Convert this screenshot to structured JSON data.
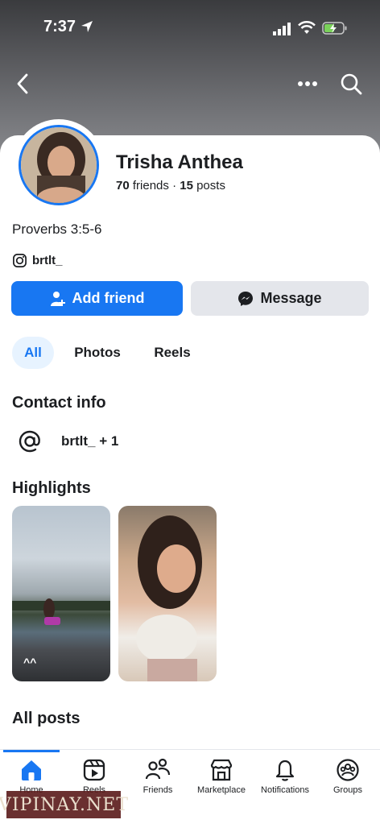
{
  "status_bar": {
    "time": "7:37"
  },
  "profile": {
    "name": "Trisha Anthea",
    "friends_count": "70",
    "friends_label": "friends",
    "separator": "·",
    "posts_count": "15",
    "posts_label": "posts",
    "bio": "Proverbs 3:5-6",
    "instagram": "brtlt_"
  },
  "actions": {
    "add_friend": "Add friend",
    "message": "Message"
  },
  "tabs": [
    {
      "label": "All",
      "active": true
    },
    {
      "label": "Photos"
    },
    {
      "label": "Reels"
    }
  ],
  "contact": {
    "heading": "Contact info",
    "value": "brtlt_ + 1"
  },
  "highlights": {
    "heading": "Highlights",
    "items": [
      {
        "caption": "^^"
      },
      {
        "caption": ""
      }
    ]
  },
  "posts": {
    "heading": "All posts"
  },
  "bottom_nav": [
    {
      "label": "Home",
      "icon": "home-icon"
    },
    {
      "label": "Reels",
      "icon": "reels-icon"
    },
    {
      "label": "Friends",
      "icon": "friends-icon"
    },
    {
      "label": "Marketplace",
      "icon": "marketplace-icon"
    },
    {
      "label": "Notifications",
      "icon": "bell-icon"
    },
    {
      "label": "Groups",
      "icon": "groups-icon"
    }
  ],
  "watermark": "VIPINAY.NET",
  "colors": {
    "accent": "#1877f2",
    "button_gray": "#e4e6eb",
    "tab_bg": "#e7f3ff"
  }
}
